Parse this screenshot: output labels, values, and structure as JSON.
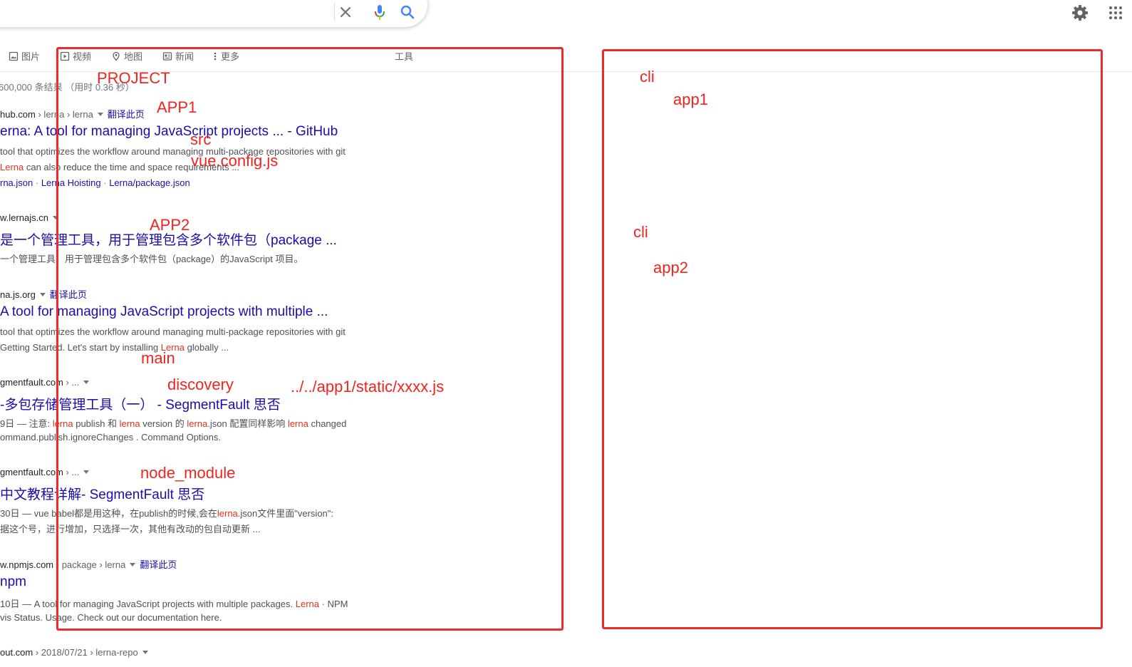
{
  "search": {
    "clear_icon": "close-icon",
    "voice_icon": "mic-icon",
    "search_icon": "search-icon"
  },
  "header": {
    "settings_icon": "gear-icon",
    "apps_icon": "apps-grid-icon"
  },
  "tabs": [
    {
      "label": "图片",
      "icon": "image-icon"
    },
    {
      "label": "视频",
      "icon": "video-icon"
    },
    {
      "label": "地图",
      "icon": "map-pin-icon"
    },
    {
      "label": "新闻",
      "icon": "news-icon"
    },
    {
      "label": "更多",
      "icon": "more-vert-icon"
    }
  ],
  "tools_label": "工具",
  "result_stats": "600,000 条结果 （用时 0.36 秒）",
  "results": [
    {
      "domain": "hub.com",
      "crumbs": " › lerna › lerna",
      "translate": "翻译此页",
      "title": "erna: A tool for managing JavaScript projects ... - GitHub",
      "snippet1": " tool that optimizes the workflow around managing multi-package repositories with git",
      "snippet2_em": "Lerna",
      "snippet2_rest": " can also reduce the time and space requirements ...",
      "sitelinks": [
        "rna.json",
        "Lerna Hoisting",
        "Lerna/package.json"
      ]
    },
    {
      "domain": "w.lernajs.cn",
      "title": " 是一个管理工具，用于管理包含多个软件包（package ...",
      "snippet1": "一个管理工具，用于管理包含多个软件包（package）的JavaScript 项目。"
    },
    {
      "domain": "na.js.org",
      "translate": "翻译此页",
      "title": " A tool for managing JavaScript projects with multiple ...",
      "snippet1": " tool that optimizes the workflow around managing multi-package repositories with git",
      "snippet2_pre": " Getting Started. Let's start by installing ",
      "snippet2_em": "Lerna",
      "snippet2_rest": " globally ..."
    },
    {
      "domain": "gmentfault.com",
      "crumbs": " › ...",
      "title": "-多包存储管理工具（一） - SegmentFault 思否",
      "snippet1_pre": "9日 — 注意: ",
      "snippet1_e1": "lerna",
      "snippet1_m1": " publish 和 ",
      "snippet1_e2": "lerna",
      "snippet1_m2": " version 的 ",
      "snippet1_e3": "lerna",
      "snippet1_m3": ".json 配置同样影响 ",
      "snippet1_e4": "lerna",
      "snippet1_m4": " changed",
      "snippet2": "ommand.publish.ignoreChanges . Command Options."
    },
    {
      "domain": "gmentfault.com",
      "crumbs": " › ...",
      "title": "中文教程详解- SegmentFault 思否",
      "snippet1_pre": "30日 — vue babel都是用这种，在publish的时候,会在",
      "snippet1_em": "lerna",
      "snippet1_rest": ".json文件里面\"version\":",
      "snippet2": " 据这个号，进行增加，只选择一次，其他有改动的包自动更新 ..."
    },
    {
      "domain": "w.npmjs.com",
      "crumbs": " › package › lerna",
      "translate": "翻译此页",
      "title": "npm",
      "snippet1_pre": "10日 — A tool for managing JavaScript projects with multiple packages. ",
      "snippet1_em": "Lerna",
      "snippet1_rest": " · NPM",
      "snippet2": "vis Status. Usage. Check out our documentation here."
    },
    {
      "domain": "out.com",
      "crumbs": " › 2018/07/21 › lerna-repo"
    }
  ],
  "annotations": {
    "project": "PROJECT",
    "app1": "APP1",
    "src": "src",
    "vue_config": "vue.config.js",
    "app2": "APP2",
    "main": "main",
    "discovery": "discovery",
    "static_path": "../../app1/static/xxxx.js",
    "node_module": "node_module",
    "cli_1": "cli",
    "app1_right": "app1",
    "cli_2": "cli",
    "app2_right": "app2"
  },
  "colors": {
    "annotation_red": "#f0241e",
    "link_blue": "#1a0dab",
    "highlight_red": "#e8301c"
  }
}
